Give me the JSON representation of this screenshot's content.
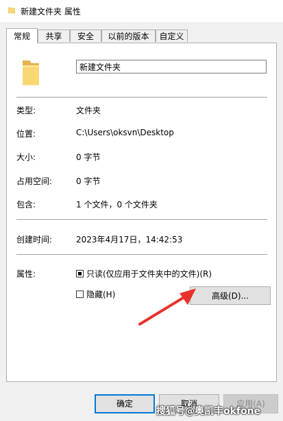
{
  "window": {
    "title": "新建文件夹 属性"
  },
  "tabs": [
    {
      "label": "常规",
      "active": true
    },
    {
      "label": "共享"
    },
    {
      "label": "安全"
    },
    {
      "label": "以前的版本"
    },
    {
      "label": "自定义"
    }
  ],
  "general": {
    "name_value": "新建文件夹",
    "type": {
      "label": "类型:",
      "value": "文件夹"
    },
    "location": {
      "label": "位置:",
      "value": "C:\\Users\\oksvn\\Desktop"
    },
    "size": {
      "label": "大小:",
      "value": "0 字节"
    },
    "size_on_disk": {
      "label": "占用空间:",
      "value": "0 字节"
    },
    "contains": {
      "label": "包含:",
      "value": "1 个文件，0 个文件夹"
    },
    "created": {
      "label": "创建时间:",
      "value": "2023年4月17日，14:42:53"
    },
    "attributes": {
      "label": "属性:",
      "readonly_label": "只读(仅应用于文件夹中的文件)(R)",
      "hidden_label": "隐藏(H)",
      "advanced_button": "高级(D)..."
    }
  },
  "buttons": {
    "ok": "确定",
    "cancel": "取消",
    "apply": "应用(A)"
  },
  "watermark": "搜狐号@奥凯丰okfone",
  "colors": {
    "folder": "#f8d775",
    "folder_dark": "#e3b34a",
    "arrow": "#e8322b",
    "focus": "#0078d7"
  }
}
